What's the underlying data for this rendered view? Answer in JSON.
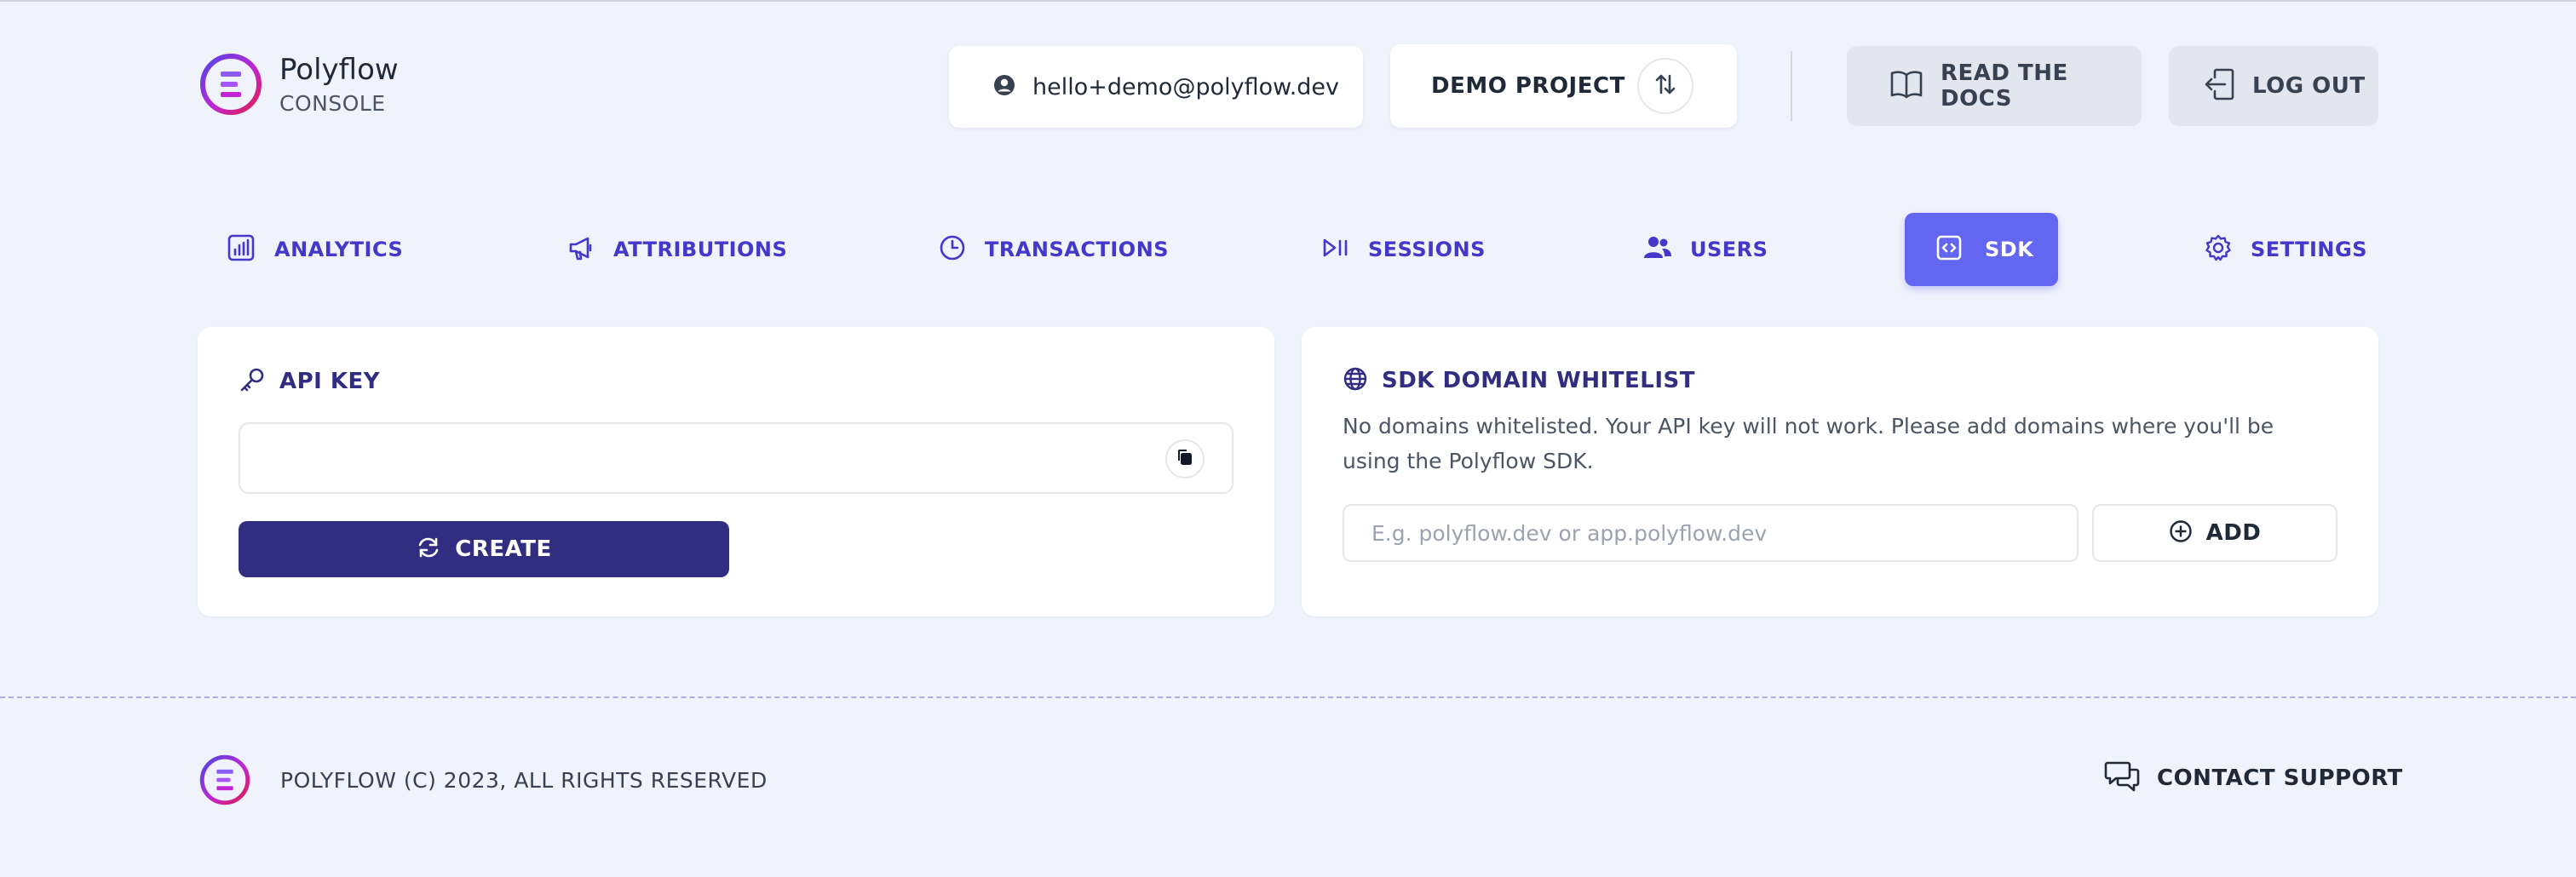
{
  "brand": {
    "name": "Polyflow",
    "subtitle": "CONSOLE"
  },
  "header": {
    "email": "hello+demo@polyflow.dev",
    "project": "DEMO PROJECT",
    "docs_label": "READ THE DOCS",
    "logout_label": "LOG OUT"
  },
  "nav": {
    "items": [
      {
        "label": "ANALYTICS",
        "icon": "chart-icon"
      },
      {
        "label": "ATTRIBUTIONS",
        "icon": "megaphone-icon"
      },
      {
        "label": "TRANSACTIONS",
        "icon": "clock-icon"
      },
      {
        "label": "SESSIONS",
        "icon": "play-pause-icon"
      },
      {
        "label": "USERS",
        "icon": "users-icon"
      },
      {
        "label": "SDK",
        "icon": "code-icon",
        "active": true
      },
      {
        "label": "SETTINGS",
        "icon": "gear-icon"
      }
    ]
  },
  "api_key": {
    "title": "API KEY",
    "value": "",
    "create_label": "CREATE"
  },
  "sdk_whitelist": {
    "title": "SDK DOMAIN WHITELIST",
    "description": "No domains whitelisted. Your API key will not work. Please add domains where you'll be using the Polyflow SDK.",
    "placeholder": "E.g. polyflow.dev or app.polyflow.dev",
    "add_label": "ADD"
  },
  "footer": {
    "copyright": "POLYFLOW (C) 2023, ALL RIGHTS RESERVED",
    "support_label": "CONTACT SUPPORT"
  },
  "colors": {
    "background": "#f0f2fc",
    "nav_text": "#4338ca",
    "nav_active_bg": "#6366f1",
    "primary_button": "#312e81"
  }
}
